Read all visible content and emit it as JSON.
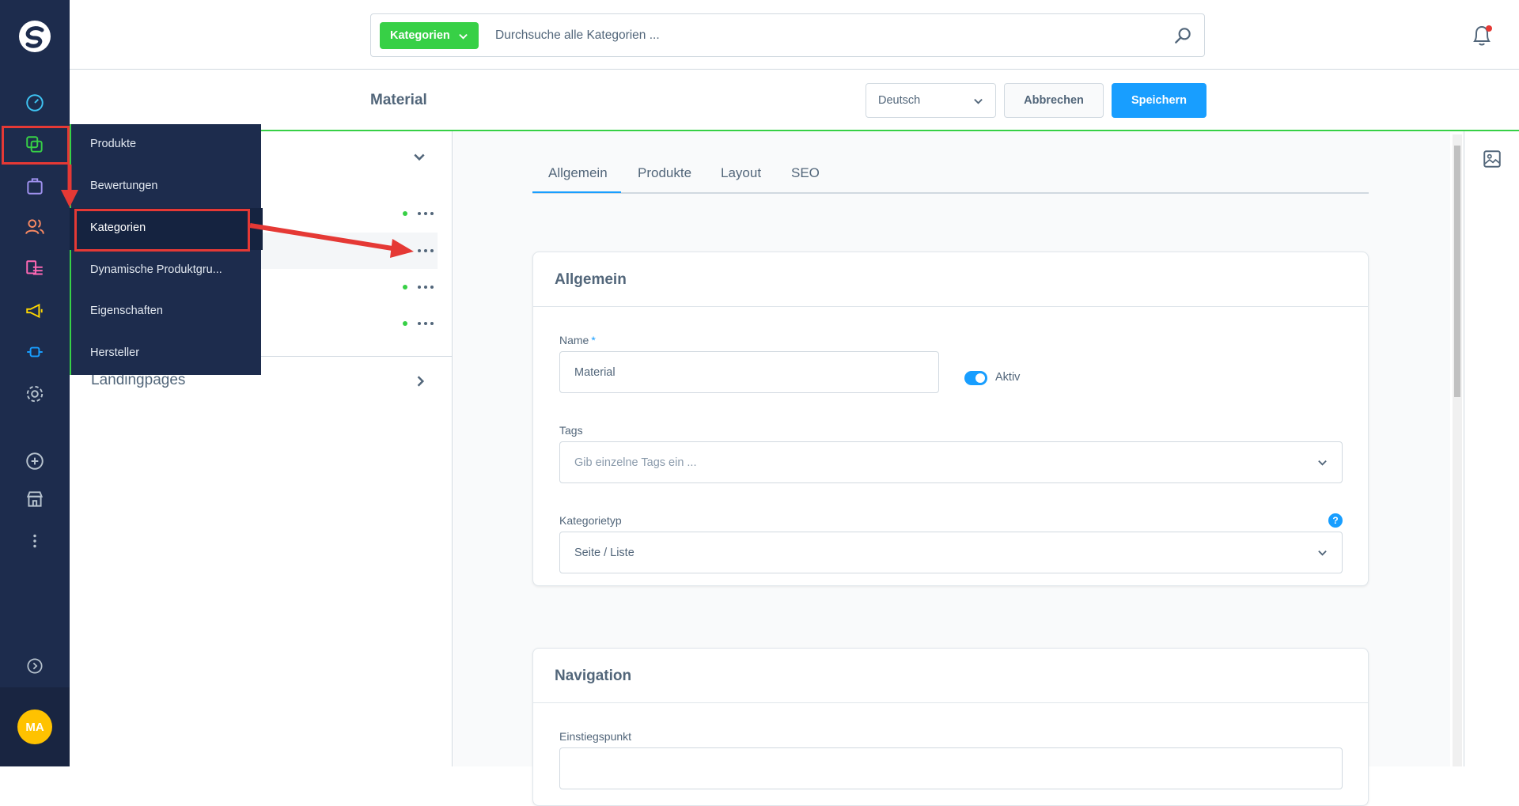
{
  "search": {
    "type_label": "Kategorien",
    "placeholder": "Durchsuche alle Kategorien ..."
  },
  "smartbar": {
    "title": "Material",
    "language": "Deutsch",
    "cancel_label": "Abbrechen",
    "save_label": "Speichern"
  },
  "flyout": {
    "items": [
      "Produkte",
      "Bewertungen",
      "Kategorien",
      "Dynamische Produktgru...",
      "Eigenschaften",
      "Hersteller"
    ]
  },
  "tree": {
    "landing_label": "Landingpages"
  },
  "tabs": [
    "Allgemein",
    "Produkte",
    "Layout",
    "SEO"
  ],
  "general_card": {
    "title": "Allgemein",
    "name_label": "Name",
    "required_mark": "*",
    "name_value": "Material",
    "active_label": "Aktiv",
    "tags_label": "Tags",
    "tags_placeholder": "Gib einzelne Tags ein ...",
    "type_label": "Kategorietyp",
    "type_value": "Seite / Liste",
    "help_glyph": "?"
  },
  "nav_card": {
    "title": "Navigation",
    "entry_label": "Einstiegspunkt"
  },
  "user": {
    "initials": "MA"
  },
  "colors": {
    "sidebar": "#1d2c4d",
    "accent_green": "#37d046",
    "primary_blue": "#189eff",
    "highlight_red": "#e53935",
    "avatar_yellow": "#ffc200"
  },
  "icons": {
    "sidebar": [
      "dashboard-icon",
      "catalog-icon",
      "orders-icon",
      "customers-icon",
      "content-icon",
      "marketing-icon",
      "extensions-icon",
      "settings-icon",
      "add-icon",
      "sales-channel-icon",
      "more-icon",
      "collapse-icon"
    ],
    "top": [
      "search-icon",
      "notification-bell-icon"
    ],
    "right_rail": [
      "media-icon"
    ]
  }
}
